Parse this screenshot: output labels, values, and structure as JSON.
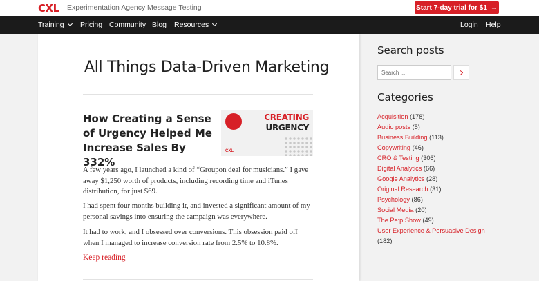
{
  "topbar": {
    "logo": "CXL",
    "links": [
      "Experimentation Agency",
      "Message Testing"
    ],
    "trial_label": "Start 7-day trial for $1",
    "trial_arrow": "→"
  },
  "nav": {
    "items": [
      {
        "label": "Training",
        "dropdown": true
      },
      {
        "label": "Pricing"
      },
      {
        "label": "Community"
      },
      {
        "label": "Blog",
        "active": true
      },
      {
        "label": "Resources",
        "dropdown": true
      }
    ],
    "right": [
      "Login",
      "Help"
    ]
  },
  "main": {
    "title": "All Things Data-Driven Marketing",
    "post": {
      "title": "How Creating a Sense of Urgency Helped Me Increase Sales By 332%",
      "thumbnail": {
        "line1": "CREATING",
        "line2": "URGENCY",
        "logo": "CXL"
      },
      "paragraphs": [
        "A few years ago, I launched a kind of “Groupon deal for musicians.” I gave away $1,250 worth of products, including recording time and iTunes distribution, for just $69.",
        "I had spent four months building it, and invested a significant amount of my personal savings into ensuring the campaign was everywhere.",
        "It had to work, and I obsessed over conversions. This obsession paid off when I managed to increase conversion rate from 2.5% to 10.8%."
      ],
      "keep_reading": "Keep reading"
    }
  },
  "sidebar": {
    "search_heading": "Search posts",
    "search_placeholder": "Search ...",
    "categories_heading": "Categories",
    "categories": [
      {
        "name": "Acquisition",
        "count": "(178)"
      },
      {
        "name": "Audio posts",
        "count": "(5)"
      },
      {
        "name": "Business Building",
        "count": "(113)"
      },
      {
        "name": "Copywriting",
        "count": "(46)"
      },
      {
        "name": "CRO & Testing",
        "count": "(306)"
      },
      {
        "name": "Digital Analytics",
        "count": "(66)"
      },
      {
        "name": "Google Analytics",
        "count": "(28)"
      },
      {
        "name": "Original Research",
        "count": "(31)"
      },
      {
        "name": "Psychology",
        "count": "(86)"
      },
      {
        "name": "Social Media",
        "count": "(20)"
      },
      {
        "name": "The Pe:p Show",
        "count": "(49)"
      },
      {
        "name": "User Experience & Persuasive Design",
        "count": "(182)"
      }
    ]
  },
  "colors": {
    "brand": "#d72027",
    "nav_bg": "#1b1b1b",
    "page_bg": "#f2f2f2"
  }
}
